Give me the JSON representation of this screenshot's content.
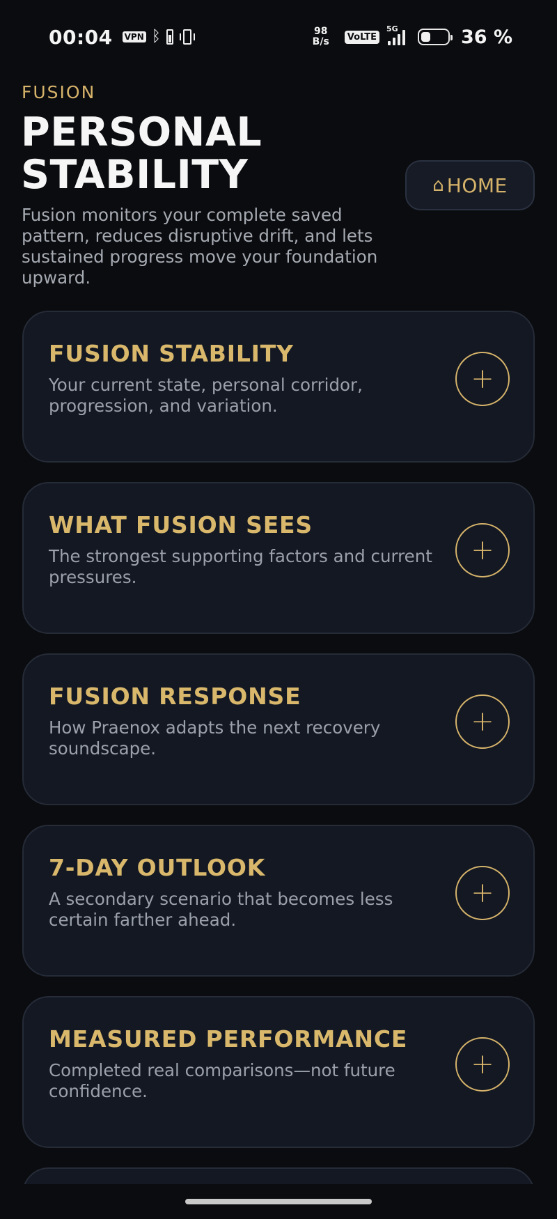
{
  "status_bar": {
    "time": "00:04",
    "vpn": "VPN",
    "net_speed_value": "98",
    "net_speed_unit": "B/s",
    "volte": "VoLTE",
    "network": "5G",
    "battery_percent": "36 %",
    "battery_level": 0.36
  },
  "header": {
    "eyebrow": "FUSION",
    "title": "PERSONAL STABILITY",
    "description": "Fusion monitors your complete saved pattern, reduces disruptive drift, and lets sustained progress move your foundation upward.",
    "home_icon": "⌂",
    "home_label": "HOME"
  },
  "cards": [
    {
      "title": "FUSION STABILITY",
      "description": "Your current state, personal corridor, progression, and variation.",
      "action": "+"
    },
    {
      "title": "WHAT FUSION SEES",
      "description": "The strongest supporting factors and current pressures.",
      "action": "+"
    },
    {
      "title": "FUSION RESPONSE",
      "description": "How Praenox adapts the next recovery soundscape.",
      "action": "+"
    },
    {
      "title": "7-DAY OUTLOOK",
      "description": "A secondary scenario that becomes less certain farther ahead.",
      "action": "+"
    },
    {
      "title": "MEASURED PERFORMANCE",
      "description": "Completed real comparisons—not future confidence.",
      "action": "+"
    }
  ],
  "colors": {
    "background": "#0b0c0f",
    "accent_gold": "#d6b36a",
    "card_background": "#131823",
    "muted_text": "#9ba0aa"
  }
}
